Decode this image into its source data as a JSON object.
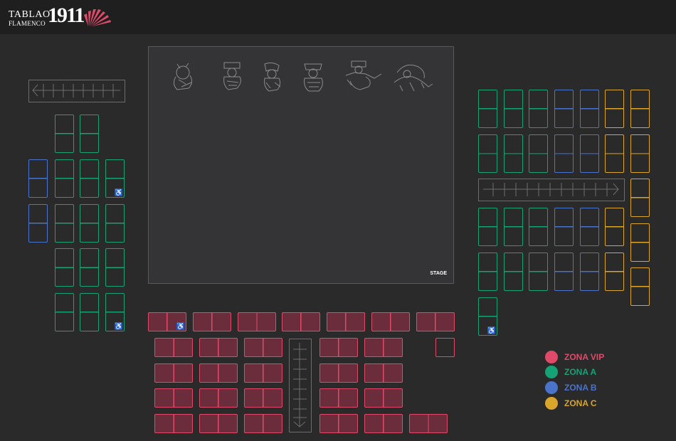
{
  "logo": {
    "line1": "TABLAO",
    "line2": "FLAMENCO",
    "number": "1911"
  },
  "stage": {
    "label": "STAGE"
  },
  "accessibility_symbol": "♿",
  "colors": {
    "vip": "#e04a69",
    "zona_a": "#15a274",
    "zona_b": "#4a73cc",
    "zona_c": "#d9a52a",
    "background": "#2a2a2b"
  },
  "legend": [
    {
      "label": "ZONA VIP",
      "color": "#e04a69"
    },
    {
      "label": "ZONA A",
      "color": "#15a274"
    },
    {
      "label": "ZONA B",
      "color": "#4a73cc"
    },
    {
      "label": "ZONA C",
      "color": "#d9a52a"
    }
  ],
  "icons": [
    "fan-logo-icon",
    "dancer-illustration-icon",
    "wheelchair-icon",
    "arrow-left-icon",
    "arrow-right-icon",
    "arrow-down-icon"
  ]
}
